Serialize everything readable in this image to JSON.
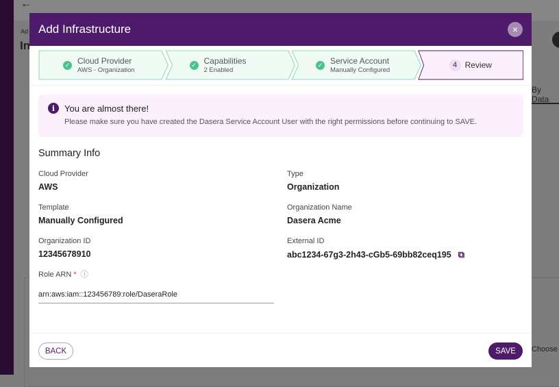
{
  "background": {
    "back_arrow": "←",
    "breadcrumb_fragment": "Ad",
    "title_fragment": "In",
    "tab_fragment": "By Data",
    "choose_fragment": "Choose"
  },
  "modal": {
    "title": "Add Infrastructure",
    "close_icon": "×",
    "steps": [
      {
        "title": "Cloud Provider",
        "subtitle": "AWS - Organization",
        "status": "complete"
      },
      {
        "title": "Capabilities",
        "subtitle": "2 Enabled",
        "status": "complete"
      },
      {
        "title": "Service Account",
        "subtitle": "Manually Configured",
        "status": "complete"
      },
      {
        "number": "4",
        "title": "Review",
        "status": "active"
      }
    ],
    "alert": {
      "title": "You are almost there!",
      "message": "Please make sure you have created the Dasera Service Account User with the right permissions before continuing to SAVE."
    },
    "summary_title": "Summary Info",
    "fields": {
      "cloud_provider": {
        "label": "Cloud Provider",
        "value": "AWS"
      },
      "type": {
        "label": "Type",
        "value": "Organization"
      },
      "template": {
        "label": "Template",
        "value": "Manually Configured"
      },
      "org_name": {
        "label": "Organization Name",
        "value": "Dasera Acme"
      },
      "org_id": {
        "label": "Organization ID",
        "value": "12345678910"
      },
      "external_id": {
        "label": "External ID",
        "value": "abc1234-67g3-2h43-cGb5-69bb82ceq195"
      }
    },
    "role_arn": {
      "label": "Role ARN",
      "required": "*",
      "info": "ⓘ",
      "value": "arn:aws:iam::123456789:role/DaseraRole"
    },
    "back_label": "BACK",
    "save_label": "SAVE"
  },
  "colors": {
    "primary": "#4e1a6a",
    "success": "#4cc38a"
  }
}
